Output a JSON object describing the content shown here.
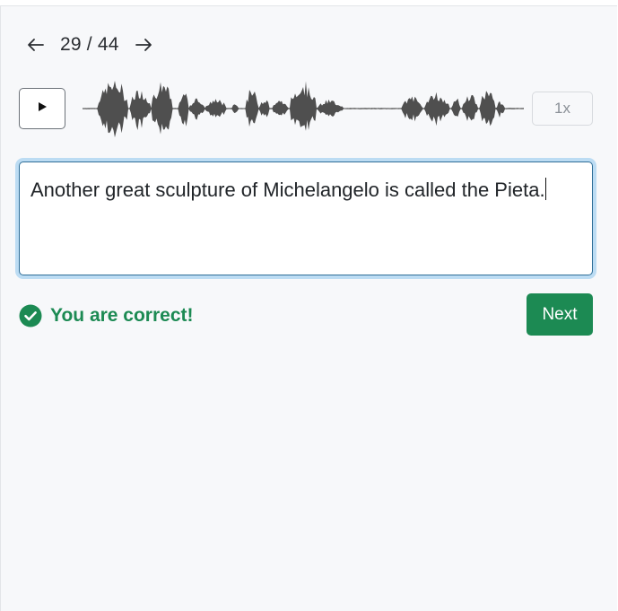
{
  "navigation": {
    "current": "29",
    "separator": "/",
    "total": "44"
  },
  "player": {
    "speed_label": "1x"
  },
  "answer": {
    "value": "Another great sculpture of Michelangelo is called the Pieta."
  },
  "feedback": {
    "message": "You are correct!",
    "next_label": "Next"
  },
  "colors": {
    "success": "#1c8a53",
    "focus_ring": "#bcdcf3",
    "waveform": "#4f4f4f"
  }
}
